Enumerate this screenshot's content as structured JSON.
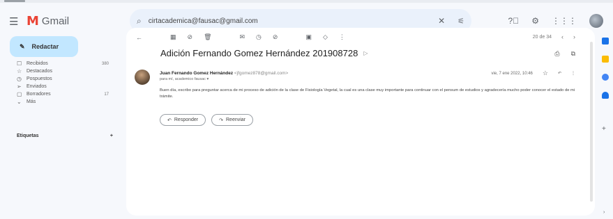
{
  "app": {
    "logo_text": "Gmail",
    "menu_icon": "hamburger-icon"
  },
  "search": {
    "value": "cirtacademica@fausac@gmail.com"
  },
  "header_icons": [
    "help-icon",
    "settings-icon",
    "apps-icon",
    "avatar"
  ],
  "compose": {
    "label": "Redactar"
  },
  "nav": [
    {
      "icon": "☐",
      "label": "Recibidos",
      "count": "380",
      "bold": true
    },
    {
      "icon": "☆",
      "label": "Destacados",
      "count": "",
      "bold": false
    },
    {
      "icon": "◷",
      "label": "Pospuestos",
      "count": "",
      "bold": false
    },
    {
      "icon": "➢",
      "label": "Enviados",
      "count": "",
      "bold": false
    },
    {
      "icon": "▢",
      "label": "Borradores",
      "count": "17",
      "bold": true
    },
    {
      "icon": "⌄",
      "label": "Más",
      "count": "",
      "bold": false
    }
  ],
  "labels": {
    "title": "Etiquetas",
    "add": "+"
  },
  "toolbar": [
    "←",
    "▦",
    "⊘",
    "🗑",
    "✉",
    "◷",
    "⊘",
    "▣",
    "◇",
    "⋮"
  ],
  "pager": {
    "text": "20 de 34",
    "prev": "‹",
    "next": "›"
  },
  "email": {
    "subject": "Adición Fernando Gomez Hernández 201908728",
    "subject_label": "▷",
    "sender_name": "Juan Fernando Gomez Hernández",
    "sender_email": "<jfgomez878@gmail.com>",
    "to": "para mí, academico fausac ▾",
    "date": "vie, 7 ene 2022, 10:46",
    "body": "Buen día, escribo para preguntar acerca de mi proceso de adición de la clase de Fisiología Vegetal, la cual es una clase muy importante para continuar con el pensum de estudios y agradecería mucho poder conocer el estado de mi trámite.",
    "reply_label": "Responder",
    "forward_label": "Reenviar"
  },
  "colors": {
    "compose_bg": "#c2e7ff",
    "search_bg": "#eaf1fb",
    "page_bg": "#f6f8fc"
  }
}
